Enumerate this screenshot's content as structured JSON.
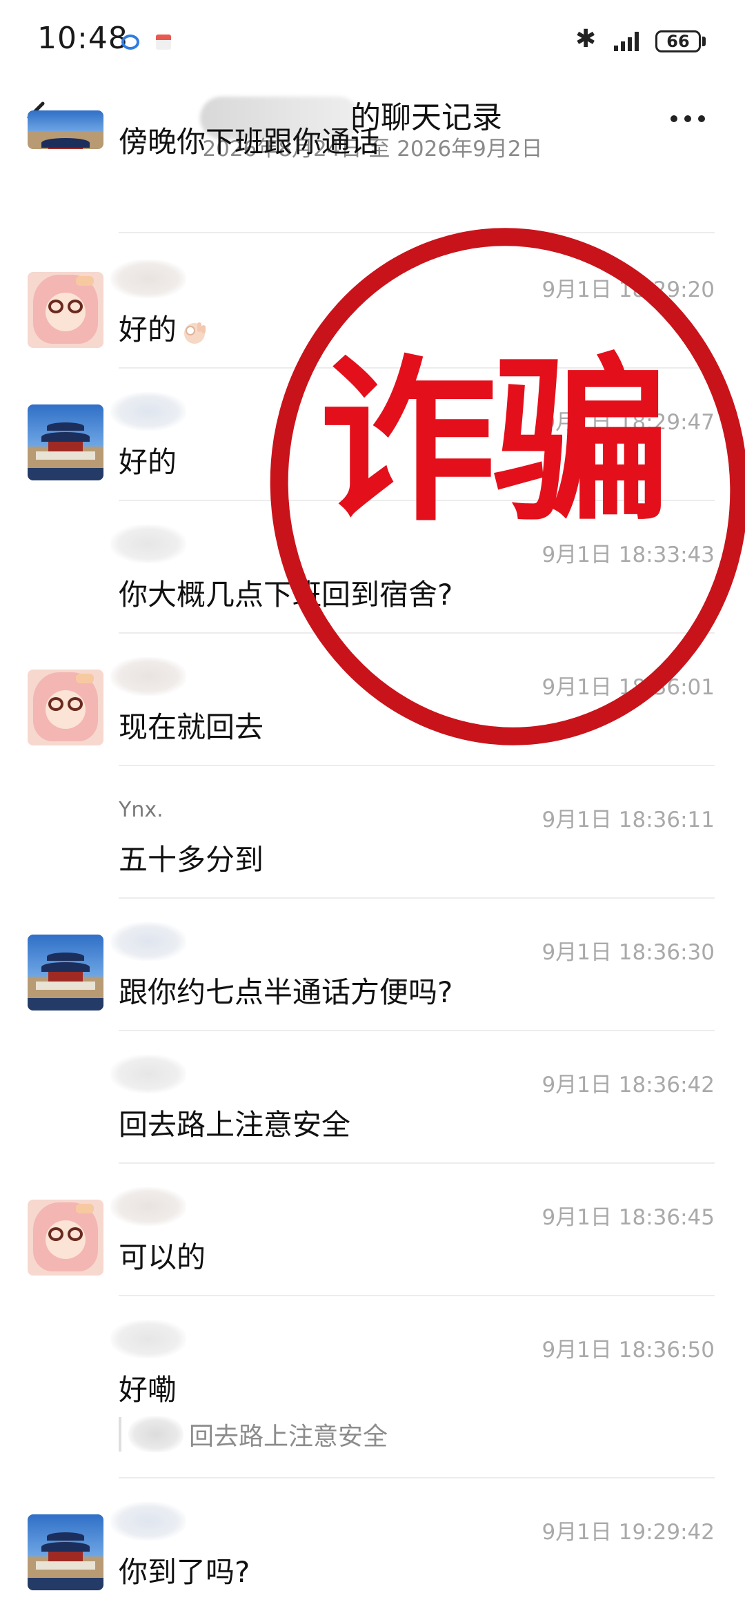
{
  "status_bar": {
    "time": "10:48",
    "battery": "66"
  },
  "header": {
    "title": "的聊天记录",
    "date_range": "2026年8月24日 至 2026年9月2日"
  },
  "watermark": {
    "text": "诈骗",
    "color": "#e3101c"
  },
  "messages": [
    {
      "avatar": "temple",
      "name": "",
      "time": "",
      "text": "傍晚你下班跟你通话"
    },
    {
      "avatar": "girl",
      "name": "",
      "time": "9月1日 18:29:20",
      "text": "好的",
      "emoji": "ok-hand"
    },
    {
      "avatar": "temple",
      "name": "",
      "time": "9月1日 18:29:47",
      "text": " 好的"
    },
    {
      "avatar": "none",
      "name": "",
      "time": "9月1日 18:33:43",
      "text": "你大概几点下班回到宿舍?"
    },
    {
      "avatar": "girl",
      "name": "",
      "time": "9月1日 18:36:01",
      "text": "现在就回去"
    },
    {
      "avatar": "none",
      "name": "Ynx.",
      "time": "9月1日 18:36:11",
      "text": "五十多分到"
    },
    {
      "avatar": "temple",
      "name": "",
      "time": "9月1日 18:36:30",
      "text": "跟你约七点半通话方便吗?"
    },
    {
      "avatar": "none",
      "name": "",
      "time": "9月1日 18:36:42",
      "text": "回去路上注意安全"
    },
    {
      "avatar": "girl",
      "name": "",
      "time": "9月1日 18:36:45",
      "text": "可以的"
    },
    {
      "avatar": "none",
      "name": "",
      "time": "9月1日 18:36:50",
      "text": "好嘞",
      "quote": "回去路上注意安全"
    },
    {
      "avatar": "temple",
      "name": "",
      "time": "9月1日 19:29:42",
      "text": "你到了吗?"
    }
  ]
}
